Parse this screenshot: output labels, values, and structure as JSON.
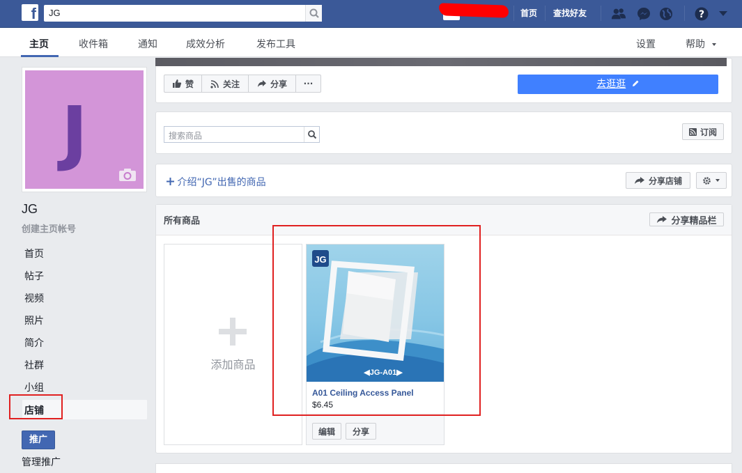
{
  "topbar": {
    "logo": "f",
    "search_value": "JG",
    "nav_home": "首页",
    "nav_find_friends": "查找好友"
  },
  "pagenav": {
    "tabs": [
      {
        "label": "主页",
        "active": true
      },
      {
        "label": "收件箱"
      },
      {
        "label": "通知"
      },
      {
        "label": "成效分析"
      },
      {
        "label": "发布工具"
      }
    ],
    "settings": "设置",
    "help": "帮助"
  },
  "profile": {
    "avatar_letter": "J",
    "page_name": "JG",
    "create_handle": "创建主页帐号"
  },
  "sidebar": {
    "items": [
      {
        "label": "首页"
      },
      {
        "label": "帖子"
      },
      {
        "label": "视频"
      },
      {
        "label": "照片"
      },
      {
        "label": "简介"
      },
      {
        "label": "社群"
      },
      {
        "label": "小组"
      },
      {
        "label": "店铺",
        "active": true
      }
    ],
    "promote": "推广",
    "manage_promotions": "管理推广"
  },
  "actions": {
    "like": "赞",
    "follow": "关注",
    "share": "分享",
    "more": "···",
    "visit": "去逛逛"
  },
  "shop": {
    "search_placeholder": "搜索商品",
    "subscribe": "订阅",
    "intro_link": "介绍“JG”出售的商品",
    "share_shop": "分享店铺",
    "all_products_title": "所有商品",
    "share_featured": "分享精品栏",
    "add_product": "添加商品"
  },
  "product": {
    "logo_text": "JG",
    "model_label": "◀JG-A01▶",
    "name": "A01 Ceiling Access Panel",
    "price": "$6.45",
    "edit": "编辑",
    "share": "分享"
  },
  "colors": {
    "topbar": "#3b5998",
    "accent_blue": "#4080ff",
    "highlight_red": "#e02020",
    "avatar_bg": "#d395d8"
  }
}
